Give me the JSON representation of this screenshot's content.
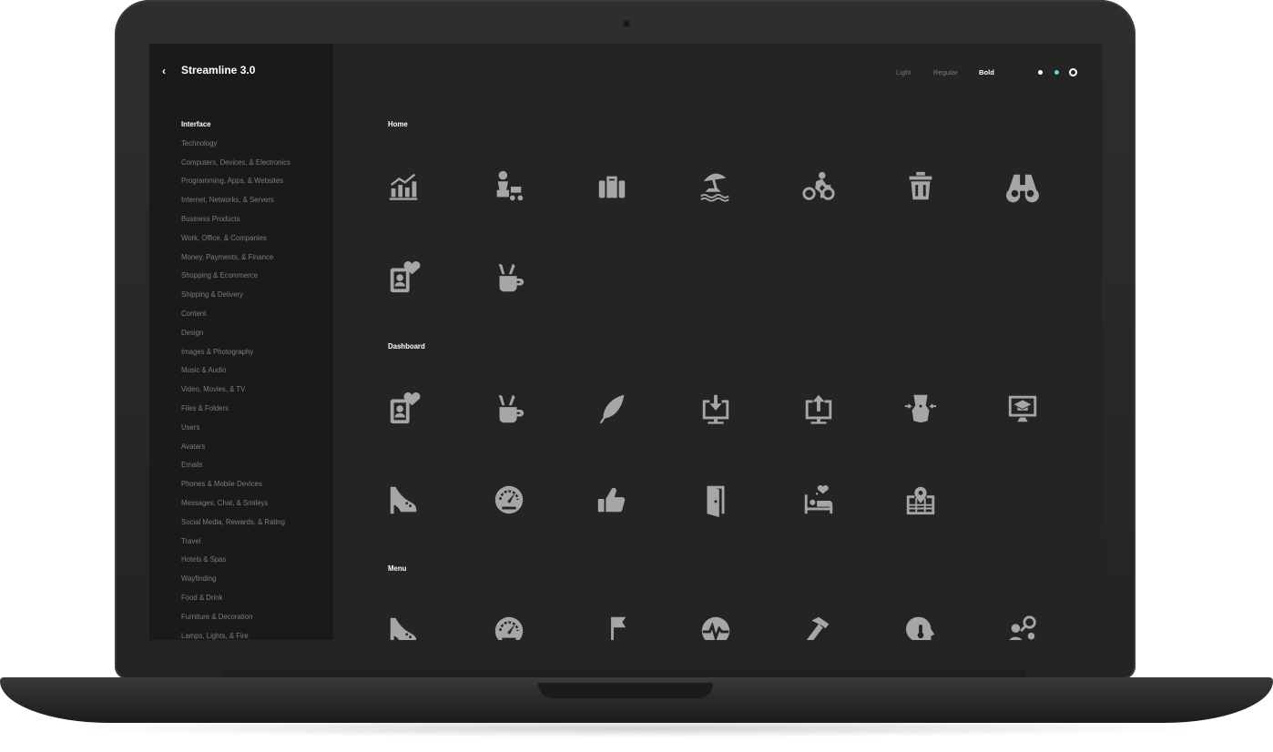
{
  "app": {
    "title": "Streamline 3.0",
    "back_icon": "chevron-left-icon"
  },
  "weights": {
    "light": "Light",
    "regular": "Regular",
    "bold": "Bold",
    "selected": "Bold"
  },
  "theme_dots": [
    {
      "name": "white",
      "color": "#ffffff"
    },
    {
      "name": "cyan",
      "color": "#5fd6d9"
    },
    {
      "name": "ring-selected",
      "color": "#ffffff"
    }
  ],
  "categories": [
    "Interface",
    "Technology",
    "Computers, Devices, & Electronics",
    "Programming, Apps, & Websites",
    "Internet, Networks, & Servers",
    "Business Products",
    "Work, Office, & Companies",
    "Money, Payments, & Finance",
    "Shopping & Ecommerce",
    "Shipping & Delivery",
    "Content",
    "Design",
    "Images & Photography",
    "Music & Audio",
    "Video, Movies, & TV",
    "Files & Folders",
    "Users",
    "Avatars",
    "Emails",
    "Phones & Mobile Devices",
    "Messages, Chat, & Smileys",
    "Social Media, Rewards, & Rating",
    "Travel",
    "Hotels & Spas",
    "Wayfinding",
    "Food & Drink",
    "Furniture & Decoration",
    "Lamps, Lights, & Fire"
  ],
  "active_category": "Interface",
  "sections": [
    {
      "title": "Home",
      "icons": [
        "analytics-bars-icon",
        "mother-stroller-icon",
        "briefcase-icon",
        "beach-umbrella-icon",
        "bicycle-rider-icon",
        "trash-bin-icon",
        "binoculars-icon",
        "contact-card-heart-icon",
        "paint-brushes-mug-icon"
      ]
    },
    {
      "title": "Dashboard",
      "icons": [
        "contact-card-heart-icon",
        "paint-brushes-mug-icon",
        "feather-quill-icon",
        "monitor-download-icon",
        "monitor-upload-icon",
        "body-waist-icon",
        "monitor-graduation-cap-icon",
        "high-heel-shoe-icon",
        "speedometer-gauge-icon",
        "thumbs-up-icon",
        "door-open-icon",
        "bed-heart-icon",
        "map-pin-grid-icon"
      ]
    },
    {
      "title": "Menu",
      "icons": [
        "high-heel-shoe-icon",
        "speedometer-gauge-icon",
        "flag-icon",
        "heartbeat-pulse-icon",
        "hammer-icon",
        "head-mind-icon",
        "people-search-icon"
      ]
    }
  ],
  "colors": {
    "icon": "#a6a6a6",
    "sidebar_bg": "#1a1a1a",
    "content_bg": "#242424",
    "accent": "#5fd6d9"
  }
}
